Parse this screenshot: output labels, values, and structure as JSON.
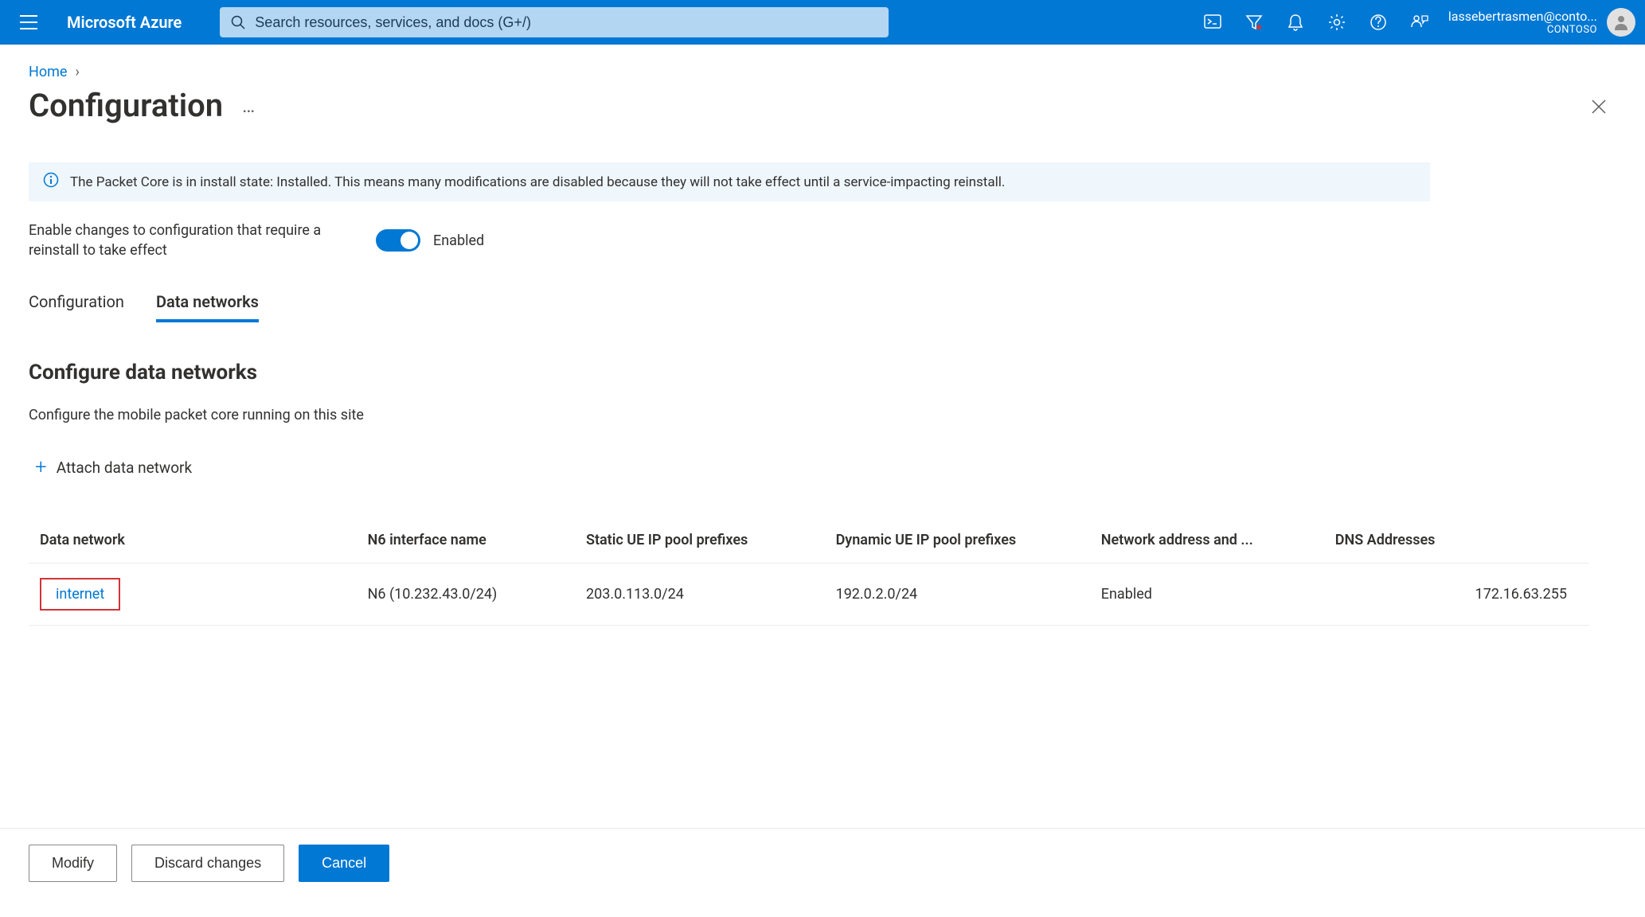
{
  "header": {
    "brand": "Microsoft Azure",
    "search_placeholder": "Search resources, services, and docs (G+/)",
    "account_email": "lassebertrasmen@conto...",
    "account_directory": "CONTOSO"
  },
  "breadcrumb": {
    "home": "Home"
  },
  "page": {
    "title": "Configuration"
  },
  "banner": {
    "text": "The Packet Core is in install state: Installed. This means many modifications are disabled because they will not take effect until a service-impacting reinstall."
  },
  "enable": {
    "label": "Enable changes to configuration that require a reinstall to take effect",
    "state": "Enabled"
  },
  "tabs": {
    "configuration": "Configuration",
    "data_networks": "Data networks"
  },
  "section": {
    "title": "Configure data networks",
    "description": "Configure the mobile packet core running on this site",
    "attach_label": "Attach data network"
  },
  "table": {
    "headers": {
      "data_network": "Data network",
      "n6": "N6 interface name",
      "static_ue": "Static UE IP pool prefixes",
      "dynamic_ue": "Dynamic UE IP pool prefixes",
      "napt": "Network address and ...",
      "dns": "DNS Addresses"
    },
    "rows": [
      {
        "data_network": "internet",
        "n6": "N6 (10.232.43.0/24)",
        "static_ue": "203.0.113.0/24",
        "dynamic_ue": "192.0.2.0/24",
        "napt": "Enabled",
        "dns": "172.16.63.255"
      }
    ]
  },
  "footer": {
    "modify": "Modify",
    "discard": "Discard changes",
    "cancel": "Cancel"
  }
}
